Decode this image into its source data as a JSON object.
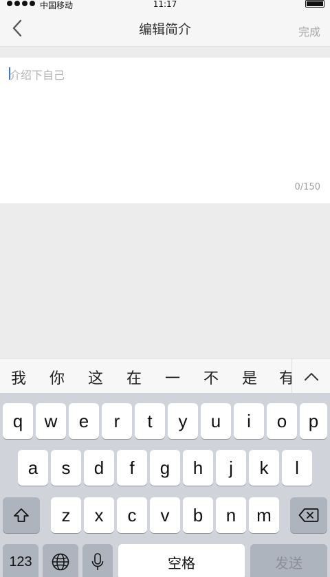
{
  "status_bar": {
    "carrier": "中国移动",
    "time": "11:17"
  },
  "nav": {
    "title": "编辑简介",
    "done_label": "完成"
  },
  "editor": {
    "placeholder": "介绍下自己",
    "counter": "0/150"
  },
  "candidates": [
    "我",
    "你",
    "这",
    "在",
    "一",
    "不",
    "是",
    "有"
  ],
  "keyboard": {
    "row1": [
      "q",
      "w",
      "e",
      "r",
      "t",
      "y",
      "u",
      "i",
      "o",
      "p"
    ],
    "row2": [
      "a",
      "s",
      "d",
      "f",
      "g",
      "h",
      "j",
      "k",
      "l"
    ],
    "row3": [
      "z",
      "x",
      "c",
      "v",
      "b",
      "n",
      "m"
    ],
    "numbers_label": "123",
    "space_label": "空格",
    "send_label": "发送"
  },
  "icons": {
    "back": "chevron-left-icon",
    "expand": "chevron-up-icon",
    "shift": "shift-icon",
    "delete": "backspace-icon",
    "globe": "globe-icon",
    "mic": "microphone-icon",
    "battery": "battery-icon"
  },
  "colors": {
    "caret": "#3b74e6",
    "keyboard_bg": "#d0d4da",
    "dark_key": "#aeb4bd"
  }
}
